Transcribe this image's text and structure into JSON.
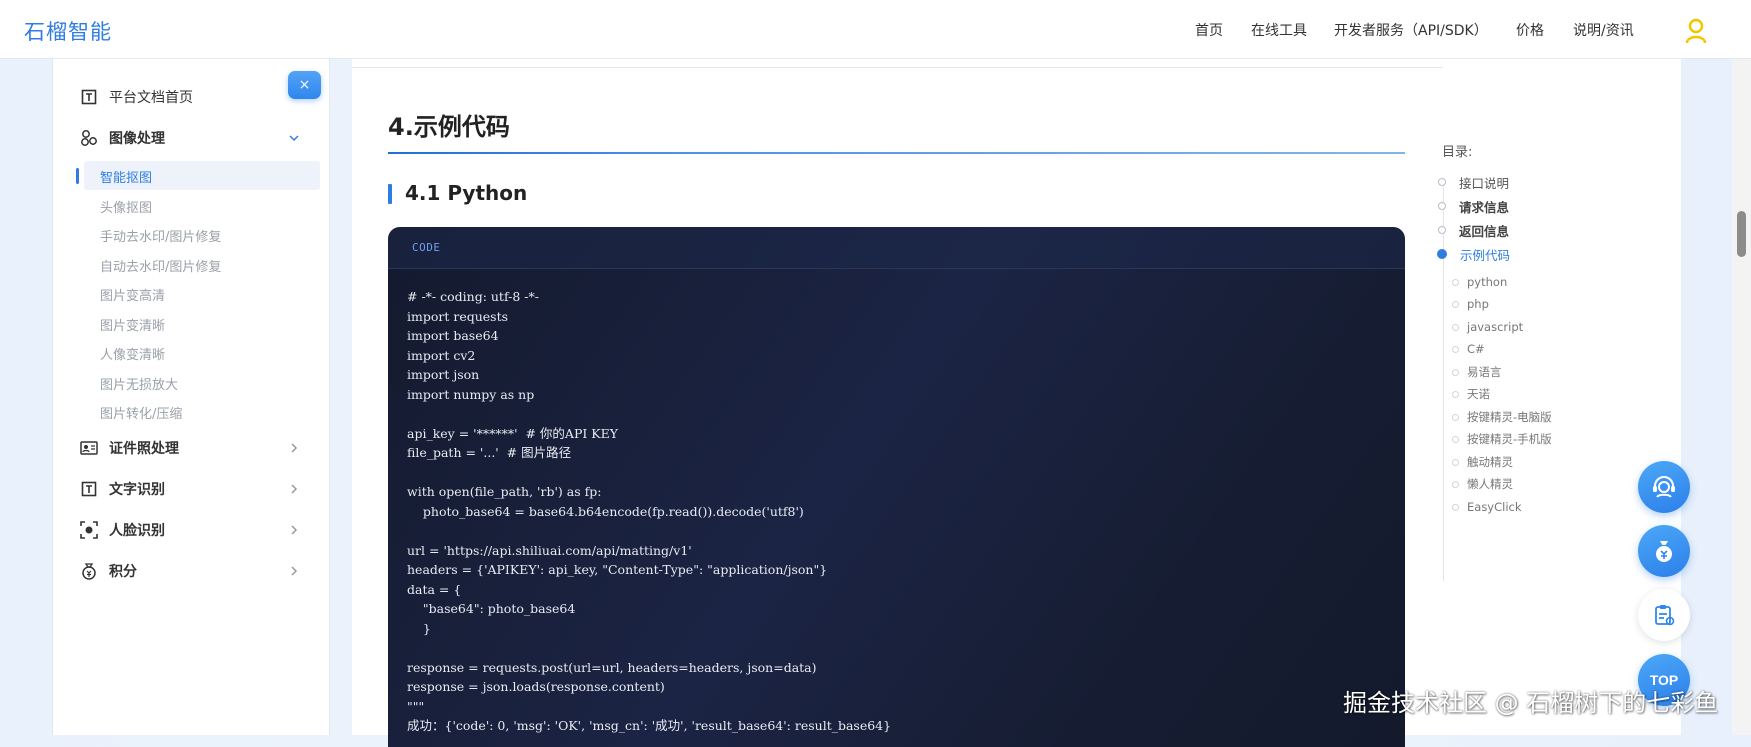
{
  "header": {
    "logo": "石榴智能",
    "nav": [
      "首页",
      "在线工具",
      "开发者服务（API/SDK）",
      "价格",
      "说明/资讯"
    ]
  },
  "sidebar": {
    "close_label": "×",
    "home": "平台文档首页",
    "image_group": "图像处理",
    "image_items": [
      "智能抠图",
      "头像抠图",
      "手动去水印/图片修复",
      "自动去水印/图片修复",
      "图片变高清",
      "图片变清晰",
      "人像变清晰",
      "图片无损放大",
      "图片转化/压缩"
    ],
    "groups": [
      "证件照处理",
      "文字识别",
      "人脸识别",
      "积分"
    ]
  },
  "main": {
    "section_title": "4.示例代码",
    "sub_title": "4.1 Python",
    "code_label": "CODE",
    "code_lines": [
      "# -*- coding: utf-8 -*-",
      "import requests",
      "import base64",
      "import cv2",
      "import json",
      "import numpy as np",
      "",
      "api_key = '******'  # 你的API KEY",
      "file_path = '...'  # 图片路径",
      "",
      "with open(file_path, 'rb') as fp:",
      "    photo_base64 = base64.b64encode(fp.read()).decode('utf8')",
      "",
      "url = 'https://api.shiliuai.com/api/matting/v1'",
      "headers = {'APIKEY': api_key, \"Content-Type\": \"application/json\"}",
      "data = {",
      "    \"base64\": photo_base64",
      "    }",
      "",
      "response = requests.post(url=url, headers=headers, json=data)",
      "response = json.loads(response.content)",
      "\"\"\"",
      "成功：{'code': 0, 'msg': 'OK', 'msg_cn': '成功', 'result_base64': result_base64}"
    ]
  },
  "toc": {
    "title": "目录:",
    "items": [
      "接口说明",
      "请求信息",
      "返回信息",
      "示例代码"
    ],
    "sub_items": [
      "python",
      "php",
      "javascript",
      "C#",
      "易语言",
      "天诺",
      "按键精灵-电脑版",
      "按键精灵-手机版",
      "触动精灵",
      "懒人精灵",
      "EasyClick"
    ]
  },
  "fab": {
    "top_label": "TOP"
  },
  "watermark": "掘金技术社区 @ 石榴树下的七彩鱼",
  "colors": {
    "accent": "#2f7de1",
    "code_bg": "#1b2444",
    "logo": "#2f7de1",
    "user_icon": "#f5c400"
  }
}
